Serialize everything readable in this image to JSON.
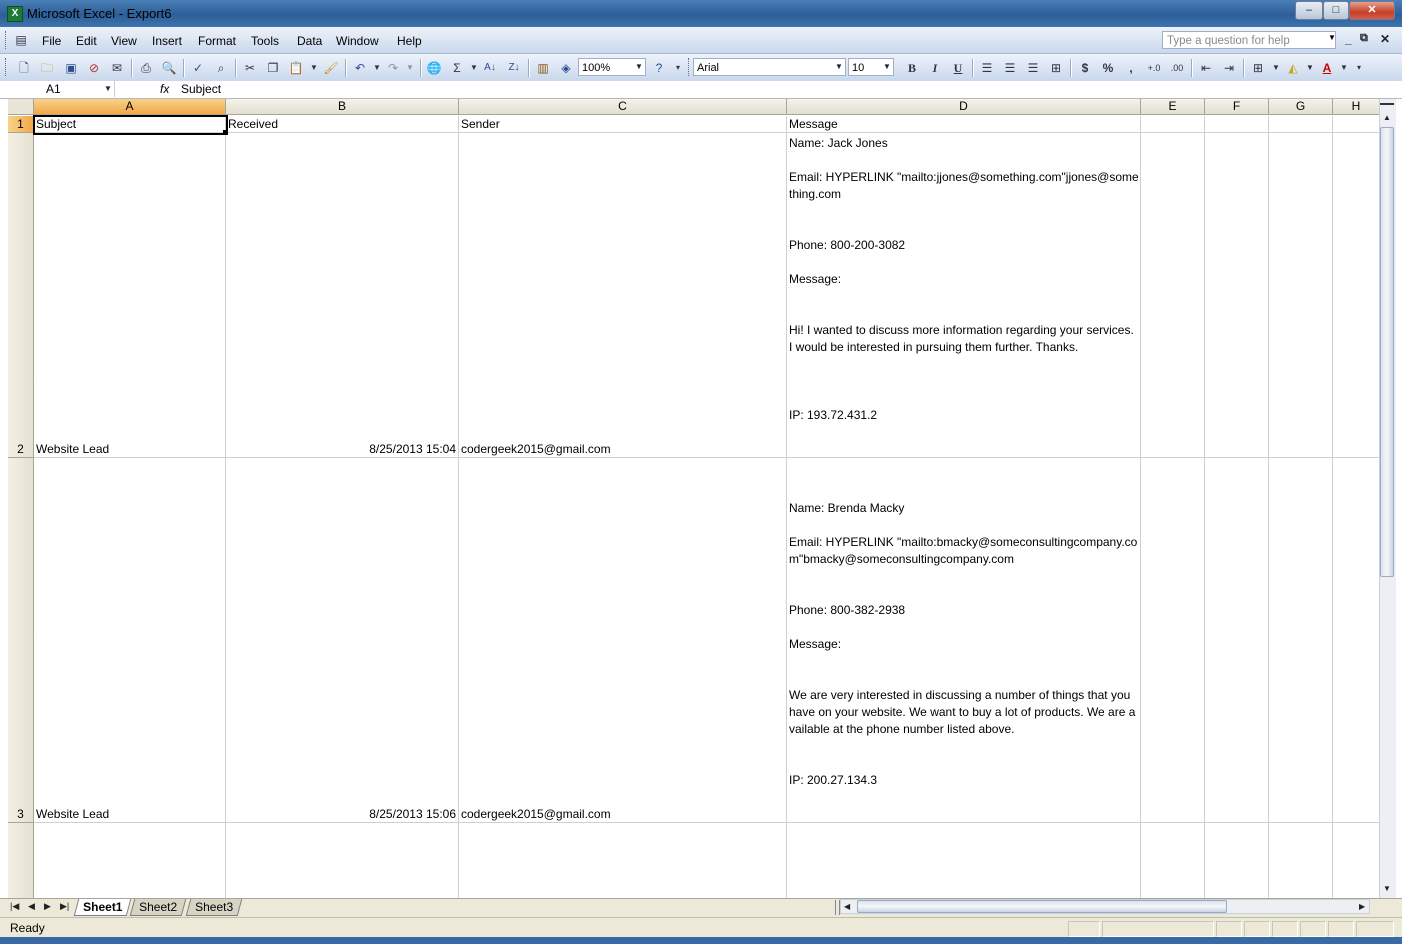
{
  "window": {
    "title": "Microsoft Excel - Export6",
    "app_icon": "excel-icon",
    "min": "–",
    "max": "□",
    "close": "✕"
  },
  "menu": {
    "items": [
      "File",
      "Edit",
      "View",
      "Insert",
      "Format",
      "Tools",
      "Data",
      "Window",
      "Help"
    ],
    "help_placeholder": "Type a question for help",
    "doc_min": "_",
    "doc_restore": "⧉",
    "doc_close": "✕"
  },
  "toolbar": {
    "zoom": "100%",
    "font": "Arial",
    "font_size": "10",
    "bold": "B",
    "italic": "I",
    "underline": "U",
    "currency": "$",
    "percent": "%",
    "comma": ",",
    "sum": "Σ"
  },
  "formula_bar": {
    "name_box": "A1",
    "fx": "fx",
    "value": "Subject"
  },
  "columns": [
    "A",
    "B",
    "C",
    "D",
    "E",
    "F",
    "G",
    "H"
  ],
  "rows": [
    {
      "num": "1",
      "subject": "Subject",
      "received": "Received",
      "sender": "Sender",
      "message": "Message"
    },
    {
      "num": "2",
      "subject": "Website Lead",
      "received": "8/25/2013 15:04",
      "sender": "codergeek2015@gmail.com",
      "message": "Name: Jack Jones\n\nEmail: HYPERLINK \"mailto:jjones@something.com\"jjones@something.com\n\n\nPhone: 800-200-3082\n\nMessage:\n\n\nHi! I wanted to discuss more information regarding your services. I would be interested in pursuing them further. Thanks.\n\n\n\nIP: 193.72.431.2"
    },
    {
      "num": "3",
      "subject": "Website Lead",
      "received": "8/25/2013 15:06",
      "sender": "codergeek2015@gmail.com",
      "message": "Name: Brenda Macky\n\nEmail: HYPERLINK \"mailto:bmacky@someconsultingcompany.com\"bmacky@someconsultingcompany.com\n\n\nPhone: 800-382-2938\n\nMessage:\n\n\nWe are very interested in discussing a number of things that you have on your website. We want to buy a lot of products. We are available at the phone number listed above.\n\n\nIP: 200.27.134.3"
    }
  ],
  "sheets": [
    "Sheet1",
    "Sheet2",
    "Sheet3"
  ],
  "active_sheet": "Sheet1",
  "status": "Ready"
}
